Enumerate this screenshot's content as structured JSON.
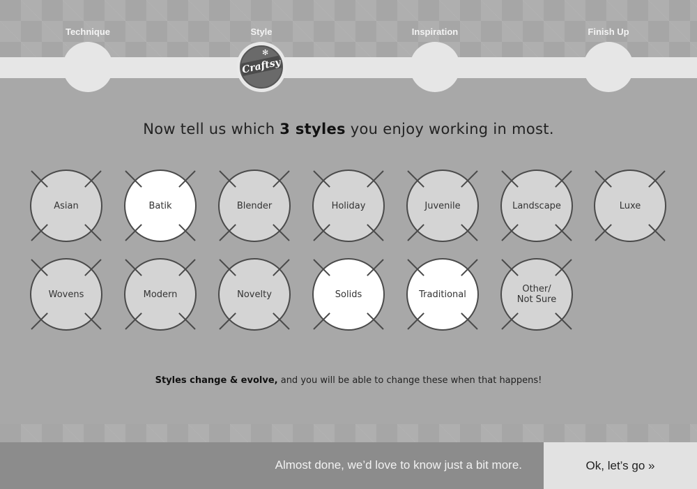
{
  "steps": [
    {
      "label": "Technique"
    },
    {
      "label": "Style"
    },
    {
      "label": "Inspiration"
    },
    {
      "label": "Finish Up"
    }
  ],
  "logo": {
    "text": "Craftsy",
    "icon": "craftsy-logo-icon"
  },
  "headline": {
    "prefix": "Now tell us which ",
    "bold": "3 styles",
    "suffix": " you enjoy working in most."
  },
  "styles": [
    {
      "label": "Asian",
      "selected": false
    },
    {
      "label": "Batik",
      "selected": true
    },
    {
      "label": "Blender",
      "selected": false
    },
    {
      "label": "Holiday",
      "selected": false
    },
    {
      "label": "Juvenile",
      "selected": false
    },
    {
      "label": "Landscape",
      "selected": false
    },
    {
      "label": "Luxe",
      "selected": false
    },
    {
      "label": "Wovens",
      "selected": false
    },
    {
      "label": "Modern",
      "selected": false
    },
    {
      "label": "Novelty",
      "selected": false
    },
    {
      "label": "Solids",
      "selected": true
    },
    {
      "label": "Traditional",
      "selected": true
    },
    {
      "label": "Other/\nNot Sure",
      "selected": false
    }
  ],
  "note": {
    "bold": "Styles change & evolve,",
    "rest": " and you will be able to change these when that happens!"
  },
  "footer": {
    "message": "Almost done, we’d love to know just a bit more.",
    "button": "Ok, let’s go »"
  },
  "colors": {
    "selected": "#ffffff",
    "unselected": "#d4d4d4",
    "footer_bar": "#8c8c8c",
    "button_bg": "#e2e2e2"
  }
}
